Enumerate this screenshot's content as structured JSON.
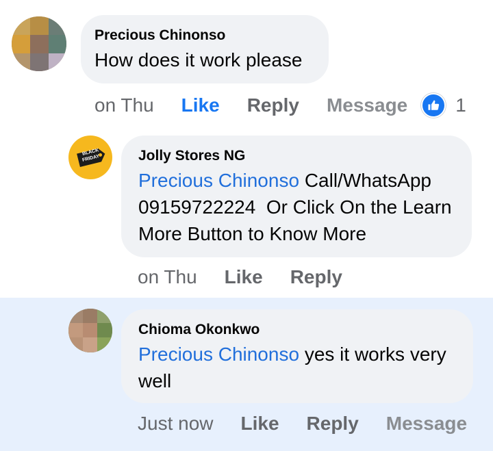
{
  "colors": {
    "mention": "#216fdb",
    "like_active": "#1877f2",
    "bubble": "#f0f2f5",
    "highlight_bg": "#e7f0fd",
    "meta_text": "#65676b"
  },
  "comments": [
    {
      "author": "Precious Chinonso",
      "text": "How does it work please",
      "time": "on Thu",
      "like": "Like",
      "reply": "Reply",
      "message": "Message",
      "reaction_icon": "like-thumb-icon",
      "reaction_count": "1"
    },
    {
      "author": "Jolly Stores NG",
      "mention": "Precious Chinonso",
      "text_line1": "Call/WhatsApp",
      "text_line2": "09159722224  Or Click On the Learn",
      "text_line3": "More Button to Know More",
      "avatar_tag_line1": "BLACK",
      "avatar_tag_line2": "FRIDAY",
      "time": "on Thu",
      "like": "Like",
      "reply": "Reply"
    },
    {
      "author": "Chioma Okonkwo",
      "mention": "Precious Chinonso",
      "text_line1": "yes it works very",
      "text_line2": "well",
      "time": "Just now",
      "like": "Like",
      "reply": "Reply",
      "message": "Message"
    }
  ]
}
